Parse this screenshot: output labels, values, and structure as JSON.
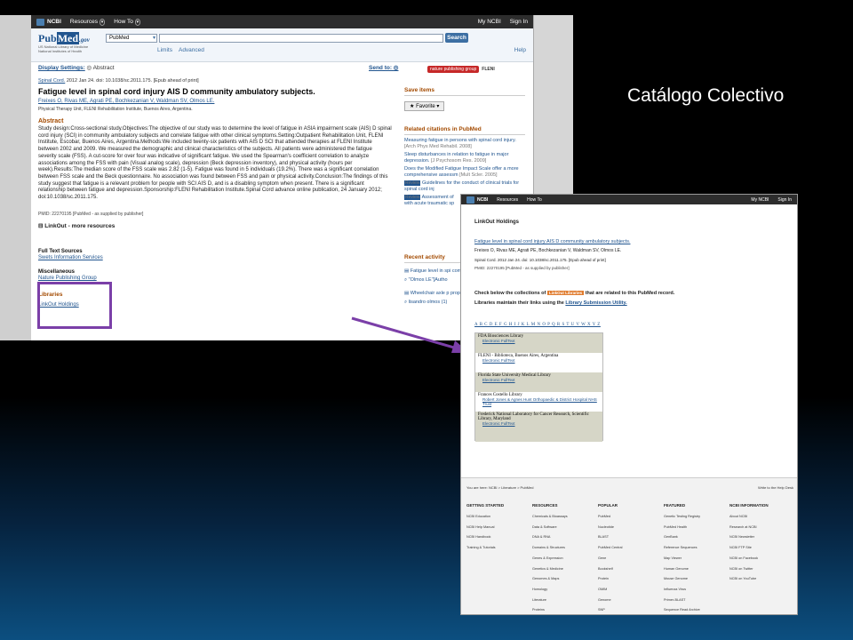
{
  "slide": {
    "title": "Catálogo Colectivo"
  },
  "pubmed": {
    "ncbi_bar": {
      "logo": "NCBI",
      "resources": "Resources",
      "howto": "How To",
      "myncbi": "My NCBI",
      "signin": "Sign In"
    },
    "logo": {
      "pub": "Pub",
      "med": "Med",
      "gov": ".gov",
      "sub1": "US National Library of Medicine",
      "sub2": "National Institutes of Health"
    },
    "db": "PubMed",
    "search_value": "",
    "search_btn": "Search",
    "limits": "Limits",
    "advanced": "Advanced",
    "help": "Help",
    "display_settings": "Display Settings:",
    "display_value": "Abstract",
    "send_to": "Send to:",
    "brand1": "nature publishing group",
    "brand2": "FLENI",
    "citation_journal": "Spinal Cord.",
    "citation_rest": "2012 Jan 24. doi: 10.1038/sc.2011.175. [Epub ahead of print]",
    "title": "Fatigue level in spinal cord injury AIS D community ambulatory subjects.",
    "authors": "Freixes O, Rivas ME, Agrati PE, Bochkezanian V, Waldman SV, Olmos LE.",
    "affiliation": "Physical Therapy Unit, FLENI Rehabilitation Institute, Buenos Aires, Argentina.",
    "abstract_heading": "Abstract",
    "abstract": "Study design:Cross-sectional study.Objectives:The objective of our study was to determine the level of fatigue in ASIA impairment scale (AIS) D spinal cord injury (SCI) in community ambulatory subjects and correlate fatigue with other clinical symptoms.Setting:Outpatient Rehabilitation Unit, FLENI Institute, Escobar, Buenos Aires, Argentina.Methods:We included twenty-six patients with AIS D SCI that attended therapies at FLENI Institute between 2002 and 2009. We measured the demographic and clinical characteristics of the subjects. All patients were administered the fatigue severity scale (FSS). A cut-score for over four was indicative of significant fatigue. We used the Spearman's coefficient correlation to analyze associations among the FSS with pain (Visual analog scale), depression (Beck depression inventory), and physical activity (hours per week).Results:The median score of the FSS scale was 2.82 (1-5). Fatigue was found in 5 individuals (19.2%). There was a significant correlation between FSS scale and the Beck questionnaire. No association was found between FSS and pain or physical activity.Conclusion:The findings of this study suggest that fatigue is a relevant problem for people with SCI AIS D, and is a disabling symptom when present. There is a significant relationship between fatigue and depression.Sponsorship:FLENI Rehabilitation Institute.Spinal Cord advance online publication, 24 January 2012; doi:10.1038/sc.2011.175.",
    "pmid": "PMID: 22270195 [PubMed - as supplied by publisher]",
    "linkout_heading": "LinkOut - more resources",
    "full_text_heading": "Full Text Sources",
    "full_text_link": "Swets Information Services",
    "misc_heading": "Miscellaneous",
    "misc_link": "Nature Publishing Group",
    "libraries_heading": "Libraries",
    "libraries_link": "LinkOut Holdings",
    "save_items": "Save items",
    "favorite": "Favorite",
    "related_heading": "Related citations in PubMed",
    "related": [
      {
        "text": "Measuring fatigue in persons with spinal cord injury.",
        "src": "[Arch Phys Med Rehabil. 2008]"
      },
      {
        "text": "Sleep disturbances in relation to fatigue in major depression.",
        "src": "[J Psychosom Res. 2009]"
      },
      {
        "text": "Does the Modified Fatigue Impact Scale offer a more comprehensive assessm",
        "src": "[Mult Scler. 2005]"
      }
    ],
    "review_label": "Review",
    "review1": "Guidelines for the conduct of clinical trials for spinal cord inj",
    "review2a": "Assessment of",
    "review2b": "with acute traumatic sp",
    "recent_heading": "Recent activity",
    "recent": [
      "Fatigue level in spi community ambul",
      "\"Olmos LE\"[Autho",
      "Wheelchair axle p propulsion perform",
      "lisandro olmos (1)"
    ]
  },
  "linkout": {
    "ncbi_bar": {
      "logo": "NCBI",
      "resources": "Resources",
      "howto": "How To",
      "myncbi": "My NCBI",
      "signin": "Sign In"
    },
    "title": "LinkOut Holdings",
    "article_link": "Fatigue level in spinal cord injury AIS D community ambulatory subjects.",
    "authors": "Freixes O, Rivas ME, Agrati PE, Bochkezanian V, Waldman SV, Olmos LE.",
    "cite": "Spinal Cord. 2012 Jan 24. doi: 10.1038/sc.2011.175. [Epub ahead of print]",
    "pmid": "PMID: 22270195 [PubMed - as supplied by publisher]",
    "inst1a": "Check below the collections of",
    "chip": "LinkOut Libraries",
    "inst1b": "that are related to this PubMed record.",
    "inst2a": "Libraries maintain their links using the",
    "inst2b": "Library Submission Utility.",
    "alphabet": "A B C D E F G H I J K L M N O P Q R S T U V W X Y Z",
    "holdings": [
      {
        "name": "FDA Biosciences Library",
        "link": "Electronic FullText",
        "shade": "g"
      },
      {
        "name": "FLENI - Biblioteca, Buenos Aires, Argentina",
        "link": "Electronic FullText",
        "shade": "w"
      },
      {
        "name": "Florida State University Medical Library",
        "link": "Electronic FullText",
        "shade": "g"
      },
      {
        "name": "Frances Costello Library",
        "link": "Robert Jones & Agnes Hunt Orthopaedic & District Hospital NHS Trust",
        "shade": "w"
      },
      {
        "name": "Frederick National Laboratory for Cancer Research, Scientific Library, Maryland",
        "link": "Electronic FullText",
        "shade": "g"
      }
    ],
    "breadcrumb": "You are here: NCBI > Literature > PubMed",
    "write_to": "Write to the Help Desk",
    "footer_cols": [
      {
        "heading": "GETTING STARTED",
        "items": [
          "NCBI Education",
          "NCBI Help Manual",
          "NCBI Handbook",
          "Training & Tutorials"
        ]
      },
      {
        "heading": "RESOURCES",
        "items": [
          "Chemicals & Bioassays",
          "Data & Software",
          "DNA & RNA",
          "Domains & Structures",
          "Genes & Expression",
          "Genetics & Medicine",
          "Genomes & Maps",
          "Homology",
          "Literature",
          "Proteins"
        ]
      },
      {
        "heading": "POPULAR",
        "items": [
          "PubMed",
          "Nucleotide",
          "BLAST",
          "PubMed Central",
          "Gene",
          "Bookshelf",
          "Protein",
          "OMIM",
          "Genome",
          "SNP"
        ]
      },
      {
        "heading": "FEATURED",
        "items": [
          "Genetic Testing Registry",
          "PubMed Health",
          "GenBank",
          "Reference Sequences",
          "Map Viewer",
          "Human Genome",
          "Mouse Genome",
          "Influenza Virus",
          "Primer-BLAST",
          "Sequence Read Archive"
        ]
      },
      {
        "heading": "NCBI INFORMATION",
        "items": [
          "About NCBI",
          "Research at NCBI",
          "NCBI Newsletter",
          "NCBI FTP Site",
          "NCBI on Facebook",
          "NCBI on Twitter",
          "NCBI on YouTube"
        ]
      }
    ]
  },
  "colors": {
    "highlight": "#7b3fa8",
    "link": "#21558f",
    "heading": "#a34a00"
  }
}
